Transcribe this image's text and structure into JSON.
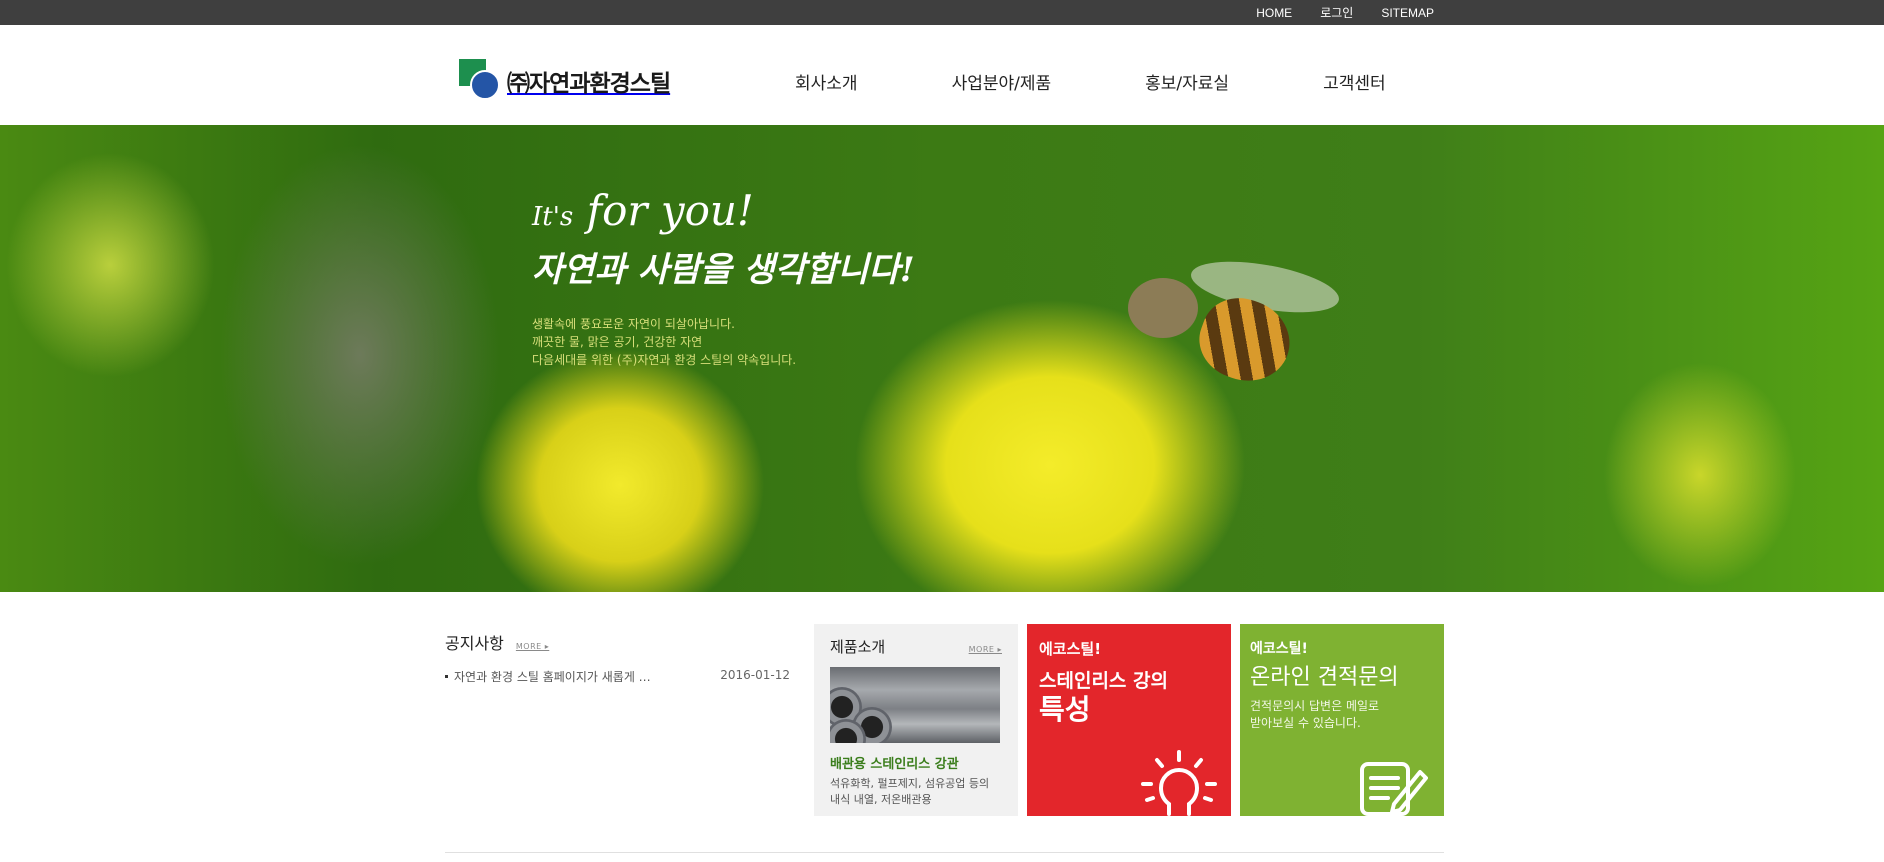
{
  "topbar": {
    "links": [
      "HOME",
      "로그인",
      "SITEMAP"
    ]
  },
  "header": {
    "logo_text": "㈜자연과환경스틸",
    "nav": [
      "회사소개",
      "사업분야/제품",
      "홍보/자료실",
      "고객센터"
    ]
  },
  "hero": {
    "line1_small": "It's",
    "line1_big": "for you!",
    "line2": "자연과 사람을 생각합니다!",
    "desc": [
      "생활속에 풍요로운 자연이 되살아납니다.",
      "깨끗한 물, 맑은 공기, 건강한 자연",
      "다음세대를 위한 (주)자연과 환경 스틸의 약속입니다."
    ]
  },
  "notice": {
    "title": "공지사항",
    "more": "MORE ▸",
    "items": [
      {
        "title": "자연과 환경 스틸 홈페이지가 새롭게 …",
        "date": "2016-01-12"
      }
    ]
  },
  "product": {
    "title": "제품소개",
    "more": "MORE ▸",
    "name": "배관용 스테인리스 강관",
    "desc": [
      "석유화학, 펄프제지, 섬유공업 등의",
      "내식 내열, 저온배관용"
    ]
  },
  "red_card": {
    "kicker": "에코스틸!",
    "line1": "스테인리스 강의",
    "line2": "특성",
    "icon": "lightbulb-icon"
  },
  "green_card": {
    "kicker": "에코스틸!",
    "headline": "온라인 견적문의",
    "sub": [
      "견적문의시 답변은 메일로",
      "받아보실 수 있습니다."
    ],
    "icon": "memo-pencil-icon"
  },
  "colors": {
    "topbar": "#3f3f3f",
    "red": "#e3262b",
    "green": "#7fb232",
    "product_name": "#3a7d1b"
  }
}
